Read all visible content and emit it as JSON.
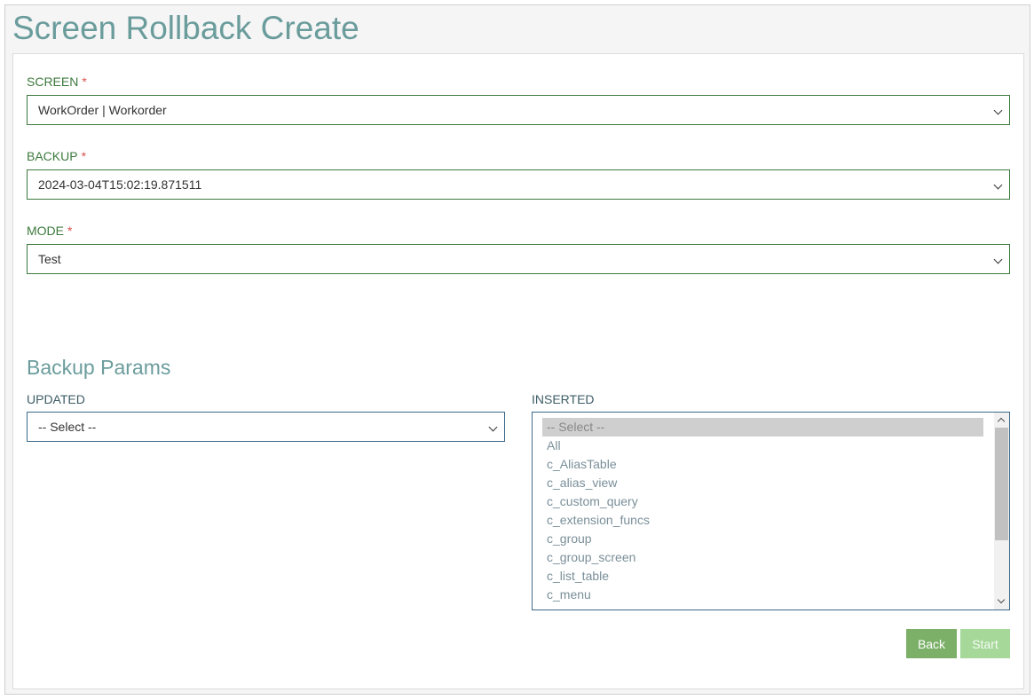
{
  "page": {
    "title": "Screen Rollback Create"
  },
  "form": {
    "required_mark": "*",
    "screen": {
      "label": "SCREEN",
      "value": "WorkOrder | Workorder"
    },
    "backup": {
      "label": "BACKUP",
      "value": "2024-03-04T15:02:19.871511"
    },
    "mode": {
      "label": "MODE",
      "value": "Test"
    }
  },
  "backup_params": {
    "title": "Backup Params",
    "updated": {
      "label": "UPDATED",
      "value": "-- Select --"
    },
    "inserted": {
      "label": "INSERTED",
      "options": [
        "-- Select --",
        "All",
        "c_AliasTable",
        "c_alias_view",
        "c_custom_query",
        "c_extension_funcs",
        "c_group",
        "c_group_screen",
        "c_list_table",
        "c_menu"
      ],
      "selected_index": 0
    }
  },
  "actions": {
    "back_label": "Back",
    "start_label": "Start"
  },
  "icons": {
    "select_arrow": "chevron-down-icon"
  },
  "colors": {
    "accent": "#6b9c9c",
    "label": "#3d7a3d",
    "required": "#d9534f",
    "back": "#7cb069",
    "start": "#a6d89a"
  }
}
